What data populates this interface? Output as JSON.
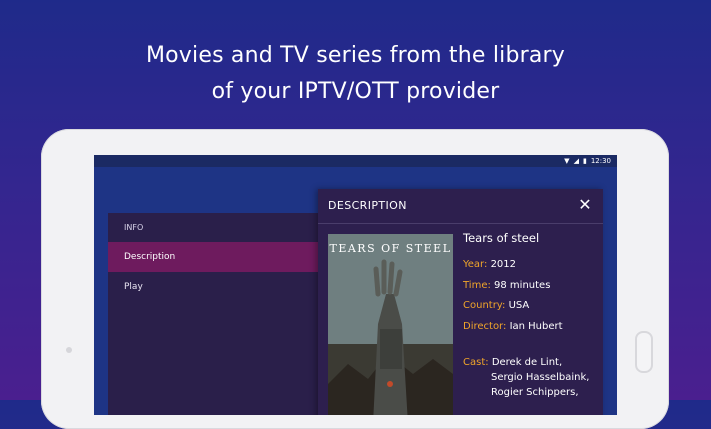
{
  "headline": {
    "line1": "Movies and TV series from the library",
    "line2": "of your IPTV/OTT provider"
  },
  "statusbar": {
    "time": "12:30"
  },
  "menu": {
    "items": [
      {
        "label": "INFO"
      },
      {
        "label": "Description"
      },
      {
        "label": "Play"
      }
    ],
    "active_index": 1
  },
  "dialog": {
    "title": "DESCRIPTION",
    "close_icon": "close-icon",
    "poster_title": "TEARS OF STEEL",
    "movie_title": "Tears of steel",
    "fields": [
      {
        "label": "Year:",
        "value": "2012"
      },
      {
        "label": "Time:",
        "value": "98 minutes"
      },
      {
        "label": "Country:",
        "value": "USA"
      },
      {
        "label": "Director:",
        "value": "Ian Hubert"
      }
    ],
    "cast_label": "Cast:",
    "cast": [
      "Derek de Lint,",
      "Sergio Hasselbaink,",
      "Rogier Schippers,"
    ]
  },
  "colors": {
    "accent_label": "#f0a52a",
    "menu_active": "#6e1b5e",
    "panel_bg": "#2a1f4a"
  }
}
